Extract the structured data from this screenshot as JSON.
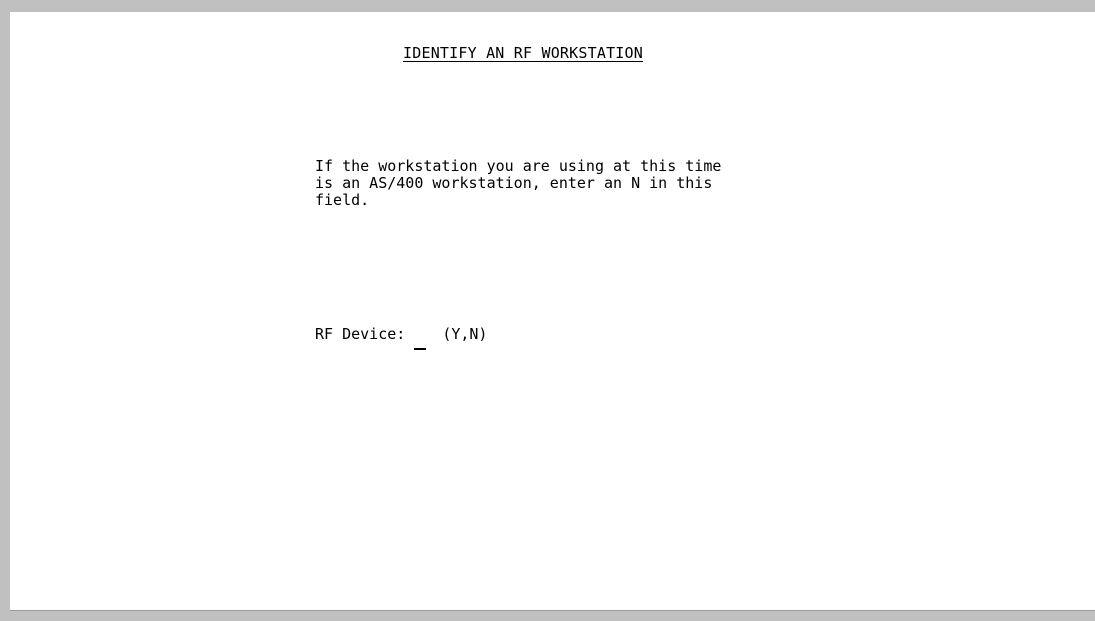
{
  "screen": {
    "title": "IDENTIFY AN RF WORKSTATION",
    "help_lines": [
      "If the workstation you are using at this time",
      "is an AS/400 workstation, enter an N in this",
      "field."
    ],
    "field": {
      "label": "RF Device:",
      "value": "",
      "hint": "(Y,N)"
    }
  }
}
